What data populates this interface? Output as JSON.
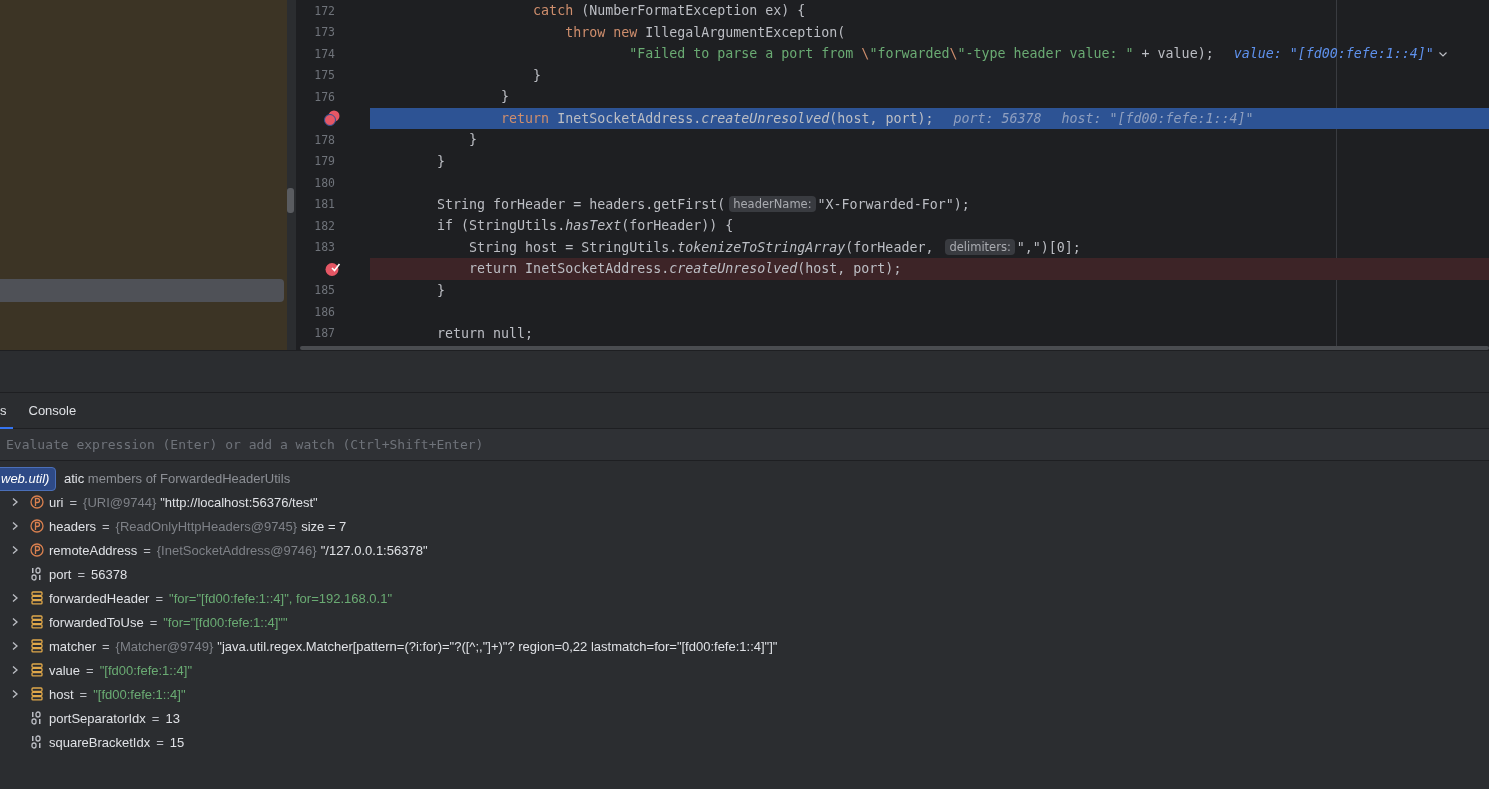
{
  "editor": {
    "lines": [
      {
        "number": "172",
        "kind": "normal",
        "tokens": [
          {
            "kind": "kw",
            "t": "                    catch"
          },
          {
            "kind": "plain",
            "t": " (NumberFormatException ex) {"
          }
        ]
      },
      {
        "number": "173",
        "kind": "normal",
        "tokens": [
          {
            "kind": "kw",
            "t": "                        throw"
          },
          {
            "kind": "kw",
            "t": " new"
          },
          {
            "kind": "plain",
            "t": " IllegalArgumentException("
          }
        ]
      },
      {
        "number": "174",
        "kind": "normal",
        "tokens": [
          {
            "kind": "str",
            "t": "                                \"Failed to parse a port from "
          },
          {
            "kind": "esc",
            "t": "\\"
          },
          {
            "kind": "str",
            "t": "\"forwarded"
          },
          {
            "kind": "esc",
            "t": "\\"
          },
          {
            "kind": "str",
            "t": "\"-type header value: \""
          },
          {
            "kind": "plain",
            "t": " + value);"
          },
          {
            "kind": "debug",
            "t": "value: \"[fd00:fefe:1::4]\"",
            "expandable": true
          }
        ]
      },
      {
        "number": "175",
        "kind": "normal",
        "tokens": [
          {
            "kind": "plain",
            "t": "                    }"
          }
        ]
      },
      {
        "number": "176",
        "kind": "normal",
        "tokens": [
          {
            "kind": "plain",
            "t": "                }"
          }
        ]
      },
      {
        "marker": {
          "kind": "stacked-breakpoint"
        },
        "kind": "current",
        "tokens": [
          {
            "kind": "kw",
            "t": "                return"
          },
          {
            "kind": "plain",
            "t": " InetSocketAddress."
          },
          {
            "kind": "method",
            "t": "createUnresolved"
          },
          {
            "kind": "plain",
            "t": "(host, port);"
          },
          {
            "kind": "debug",
            "t": "port: 56378"
          },
          {
            "kind": "debug",
            "t": "host: \"[fd00:fefe:1::4]\""
          }
        ]
      },
      {
        "number": "178",
        "kind": "normal",
        "tokens": [
          {
            "kind": "plain",
            "t": "            }"
          }
        ]
      },
      {
        "number": "179",
        "kind": "normal",
        "tokens": [
          {
            "kind": "plain",
            "t": "        }"
          }
        ]
      },
      {
        "number": "180",
        "kind": "normal"
      },
      {
        "number": "181",
        "kind": "normal",
        "tokens": [
          {
            "kind": "plain",
            "t": "        String forHeader = headers.getFirst("
          },
          {
            "kind": "hint",
            "t": "headerName:"
          },
          {
            "kind": "plain",
            "t": "\"X-Forwarded-For\");"
          }
        ]
      },
      {
        "number": "182",
        "kind": "normal",
        "tokens": [
          {
            "kind": "plain",
            "t": "        if (StringUtils."
          },
          {
            "kind": "method",
            "t": "hasText"
          },
          {
            "kind": "plain",
            "t": "(forHeader)) {"
          }
        ]
      },
      {
        "number": "183",
        "kind": "normal",
        "tokens": [
          {
            "kind": "plain",
            "t": "            String host = StringUtils."
          },
          {
            "kind": "method",
            "t": "tokenizeToStringArray"
          },
          {
            "kind": "plain",
            "t": "(forHeader, "
          },
          {
            "kind": "hint",
            "t": "delimiters:"
          },
          {
            "kind": "plain",
            "t": "\",\")[0];"
          }
        ]
      },
      {
        "marker": {
          "kind": "verified-breakpoint"
        },
        "kind": "breakpoint",
        "tokens": [
          {
            "kind": "plain",
            "t": "            return InetSocketAddress."
          },
          {
            "kind": "method",
            "t": "createUnresolved"
          },
          {
            "kind": "plain",
            "t": "(host, port);"
          }
        ]
      },
      {
        "number": "185",
        "kind": "normal",
        "tokens": [
          {
            "kind": "plain",
            "t": "        }"
          }
        ]
      },
      {
        "number": "186",
        "kind": "normal"
      },
      {
        "number": "187",
        "kind": "normal",
        "tokens": [
          {
            "kind": "plain",
            "t": "        return null;"
          }
        ]
      }
    ]
  },
  "debugger": {
    "tabs": [
      {
        "label": "s",
        "selected": true
      },
      {
        "label": "Console",
        "selected": false
      }
    ],
    "evaluate": {
      "placeholder": "Evaluate expression (Enter) or add a watch (Ctrl+Shift+Enter)"
    },
    "popup": "web.util)",
    "static_row": {
      "lead": "atic",
      "rest": " members of ForwardedHeaderUtils"
    },
    "variables": [
      {
        "name": "uri",
        "kind": "field",
        "expandable": true,
        "equals": "=",
        "type": "{URI@9744}",
        "value": "\"http://localhost:56376/test\""
      },
      {
        "name": "headers",
        "kind": "field",
        "expandable": true,
        "equals": "=",
        "type": "{ReadOnlyHttpHeaders@9745}",
        "value": "size = 7"
      },
      {
        "name": "remoteAddress",
        "kind": "field",
        "expandable": true,
        "equals": "=",
        "type": "{InetSocketAddress@9746}",
        "value": "\"/127.0.0.1:56378\""
      },
      {
        "name": "port",
        "kind": "primitive",
        "expandable": false,
        "equals": "=",
        "value": "56378"
      },
      {
        "name": "forwardedHeader",
        "kind": "string",
        "expandable": true,
        "equals": "=",
        "value": "\"for=\"[fd00:fefe:1::4]\", for=192.168.0.1\""
      },
      {
        "name": "forwardedToUse",
        "kind": "string",
        "expandable": true,
        "equals": "=",
        "value": "\"for=\"[fd00:fefe:1::4]\"\""
      },
      {
        "name": "matcher",
        "kind": "object",
        "expandable": true,
        "equals": "=",
        "type": "{Matcher@9749}",
        "value": "\"java.util.regex.Matcher[pattern=(?i:for)=\"?([^;,\"]+)\"? region=0,22 lastmatch=for=\"[fd00:fefe:1::4]\"]\""
      },
      {
        "name": "value",
        "kind": "string",
        "expandable": true,
        "equals": "=",
        "value": "\"[fd00:fefe:1::4]\""
      },
      {
        "name": "host",
        "kind": "string",
        "expandable": true,
        "equals": "=",
        "value": "\"[fd00:fefe:1::4]\""
      },
      {
        "name": "portSeparatorIdx",
        "kind": "primitive",
        "expandable": false,
        "equals": "=",
        "value": "13"
      },
      {
        "name": "squareBracketIdx",
        "kind": "primitive",
        "expandable": false,
        "equals": "=",
        "value": "15"
      }
    ]
  }
}
